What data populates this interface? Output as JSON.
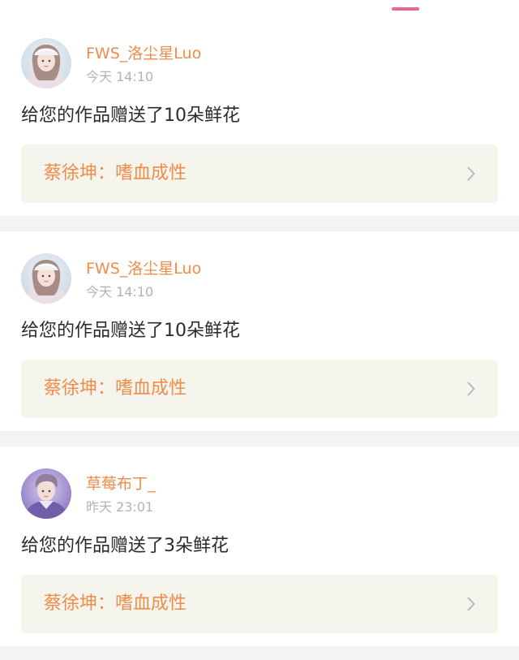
{
  "notifications": [
    {
      "username": "FWS_洛尘星Luo",
      "time": "今天 14:10",
      "message": "给您的作品赠送了10朵鲜花",
      "work_title": "蔡徐坤：嗜血成性",
      "avatar_icon": "user-avatar-girl"
    },
    {
      "username": "FWS_洛尘星Luo",
      "time": "今天 14:10",
      "message": "给您的作品赠送了10朵鲜花",
      "work_title": "蔡徐坤：嗜血成性",
      "avatar_icon": "user-avatar-girl"
    },
    {
      "username": "草莓布丁_",
      "time": "昨天 23:01",
      "message": "给您的作品赠送了3朵鲜花",
      "work_title": "蔡徐坤：嗜血成性",
      "avatar_icon": "user-avatar-boy"
    }
  ],
  "colors": {
    "username": "#ef8c4a",
    "timestamp": "#b3b3b3",
    "message": "#2b2b2b",
    "work_card_bg": "#f5f4ed",
    "tab_indicator": "#e7669a",
    "page_bg": "#f3f3f3"
  }
}
